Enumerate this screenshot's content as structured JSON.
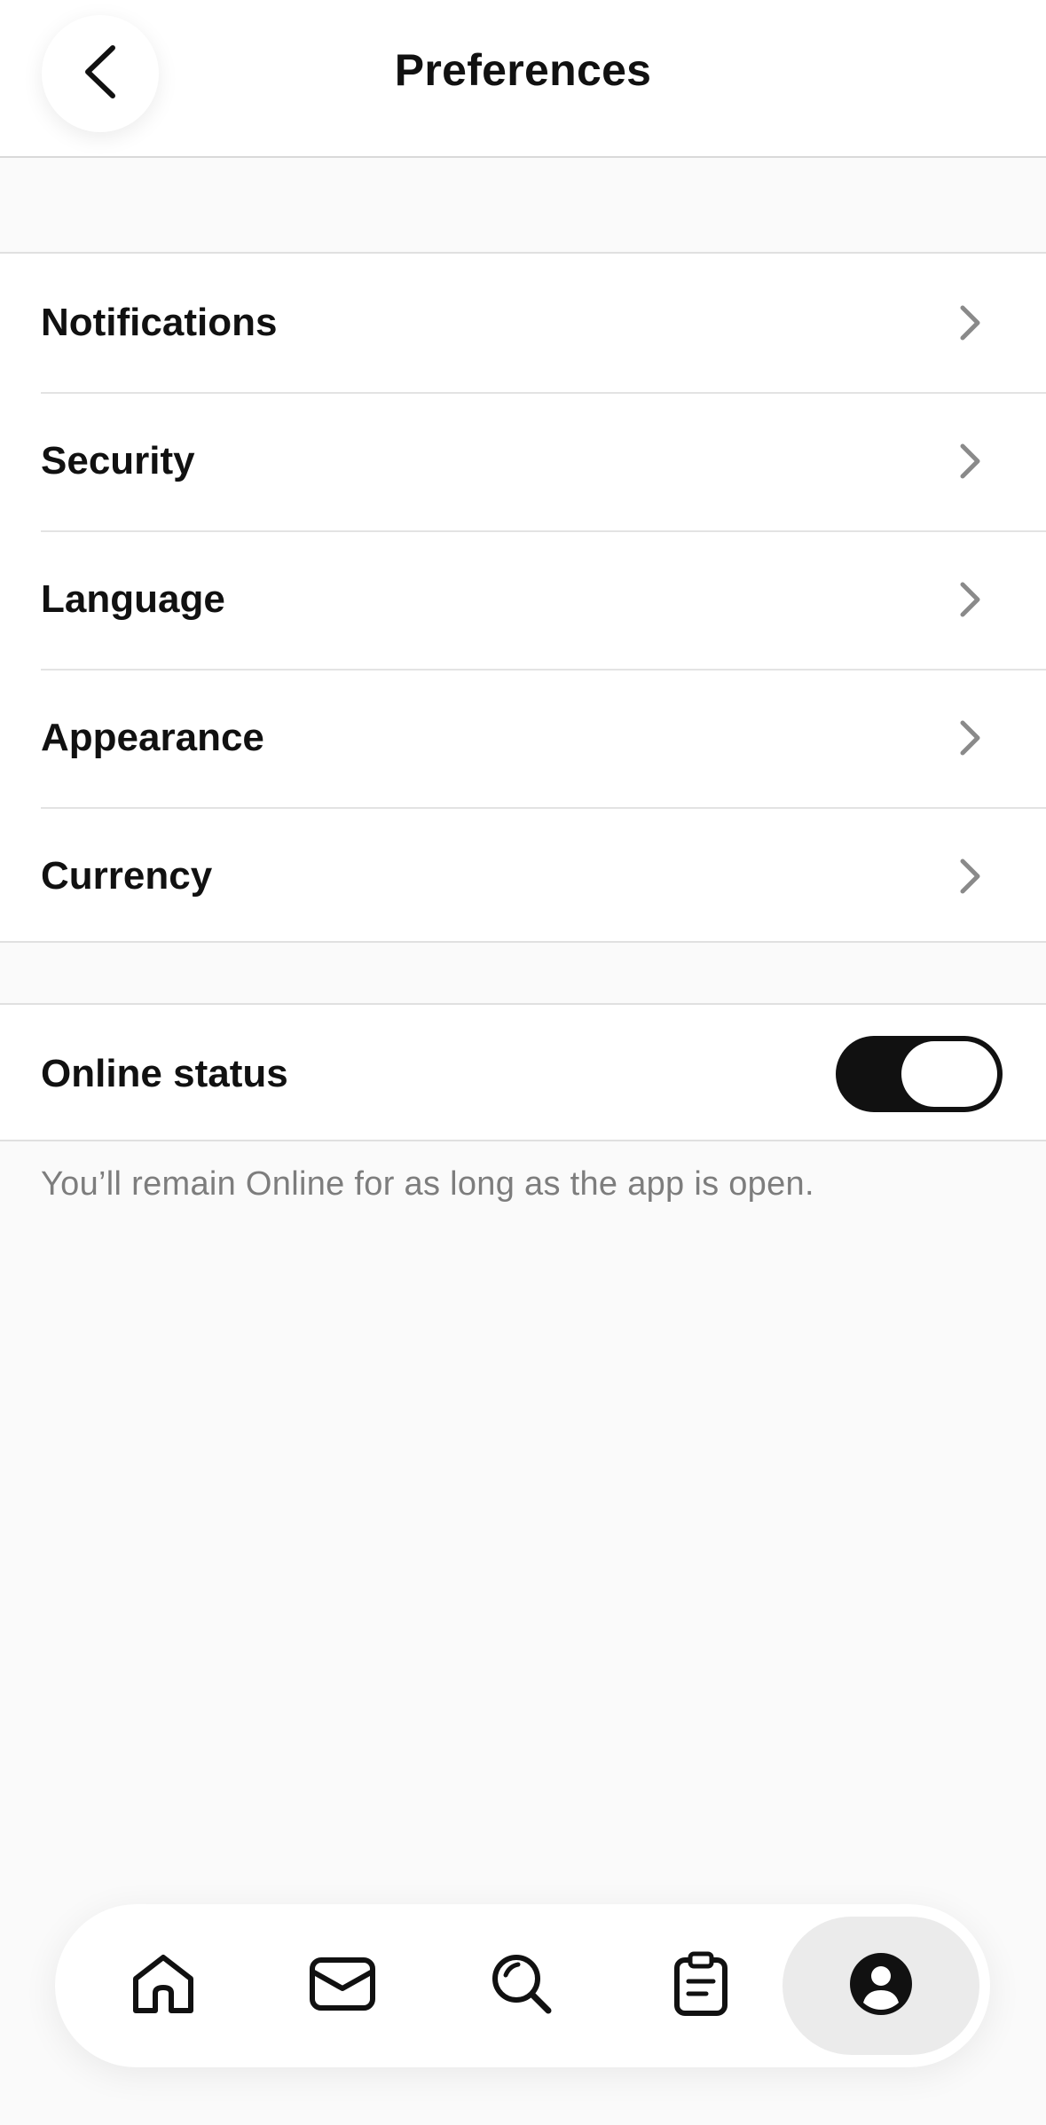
{
  "header": {
    "title": "Preferences",
    "back_icon": "chevron-left-icon"
  },
  "settings": {
    "items": [
      {
        "label": "Notifications",
        "icon": "chevron-right-icon"
      },
      {
        "label": "Security",
        "icon": "chevron-right-icon"
      },
      {
        "label": "Language",
        "icon": "chevron-right-icon"
      },
      {
        "label": "Appearance",
        "icon": "chevron-right-icon"
      },
      {
        "label": "Currency",
        "icon": "chevron-right-icon"
      }
    ]
  },
  "online_status": {
    "label": "Online status",
    "enabled": true,
    "note": "You’ll remain Online for as long as the app is open."
  },
  "bottom_nav": {
    "items": [
      {
        "icon": "home-icon"
      },
      {
        "icon": "inbox-icon"
      },
      {
        "icon": "search-icon"
      },
      {
        "icon": "clipboard-icon"
      },
      {
        "icon": "profile-icon",
        "active": true
      }
    ]
  },
  "colors": {
    "background": "#fafafa",
    "surface": "#ffffff",
    "text": "#111111",
    "muted_text": "#7d7d7d",
    "chevron": "#8a8a8a",
    "toggle_on": "#111111",
    "active_tab": "#ebebeb"
  }
}
